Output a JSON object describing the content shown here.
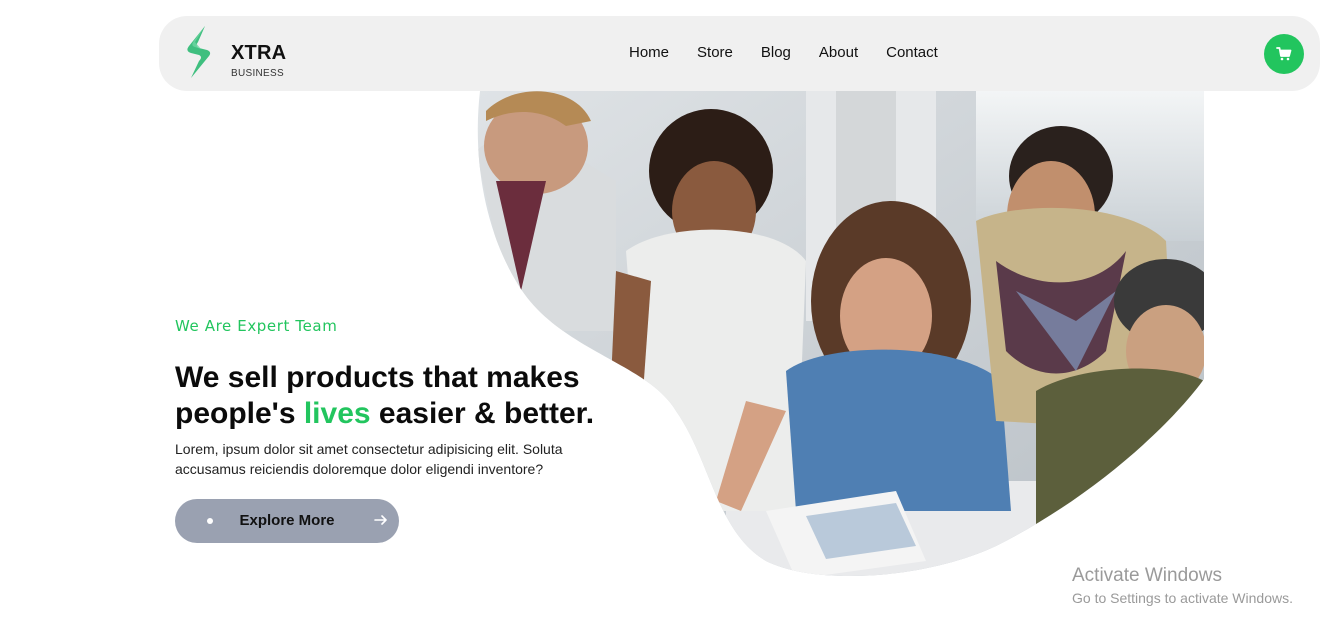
{
  "brand": {
    "name": "XTRA",
    "tagline": "BUSINESS",
    "logo_icon": "lightning-bolt-logo",
    "accent_color": "#22c55e"
  },
  "nav": {
    "items": [
      {
        "label": "Home"
      },
      {
        "label": "Store"
      },
      {
        "label": "Blog"
      },
      {
        "label": "About"
      },
      {
        "label": "Contact"
      }
    ],
    "cart_icon": "cart-icon"
  },
  "hero": {
    "eyebrow": "We Are Expert Team",
    "headline_part1": "We sell products that makes people's ",
    "headline_highlight": "lives",
    "headline_part2": " easier & better.",
    "description": "Lorem, ipsum dolor sit amet consectetur adipisicing elit. Soluta accusamus reiciendis doloremque dolor eligendi inventore?",
    "cta_label": "Explore More",
    "image": "team-photo"
  },
  "watermark": {
    "title": "Activate Windows",
    "subtitle": "Go to Settings to activate Windows."
  }
}
